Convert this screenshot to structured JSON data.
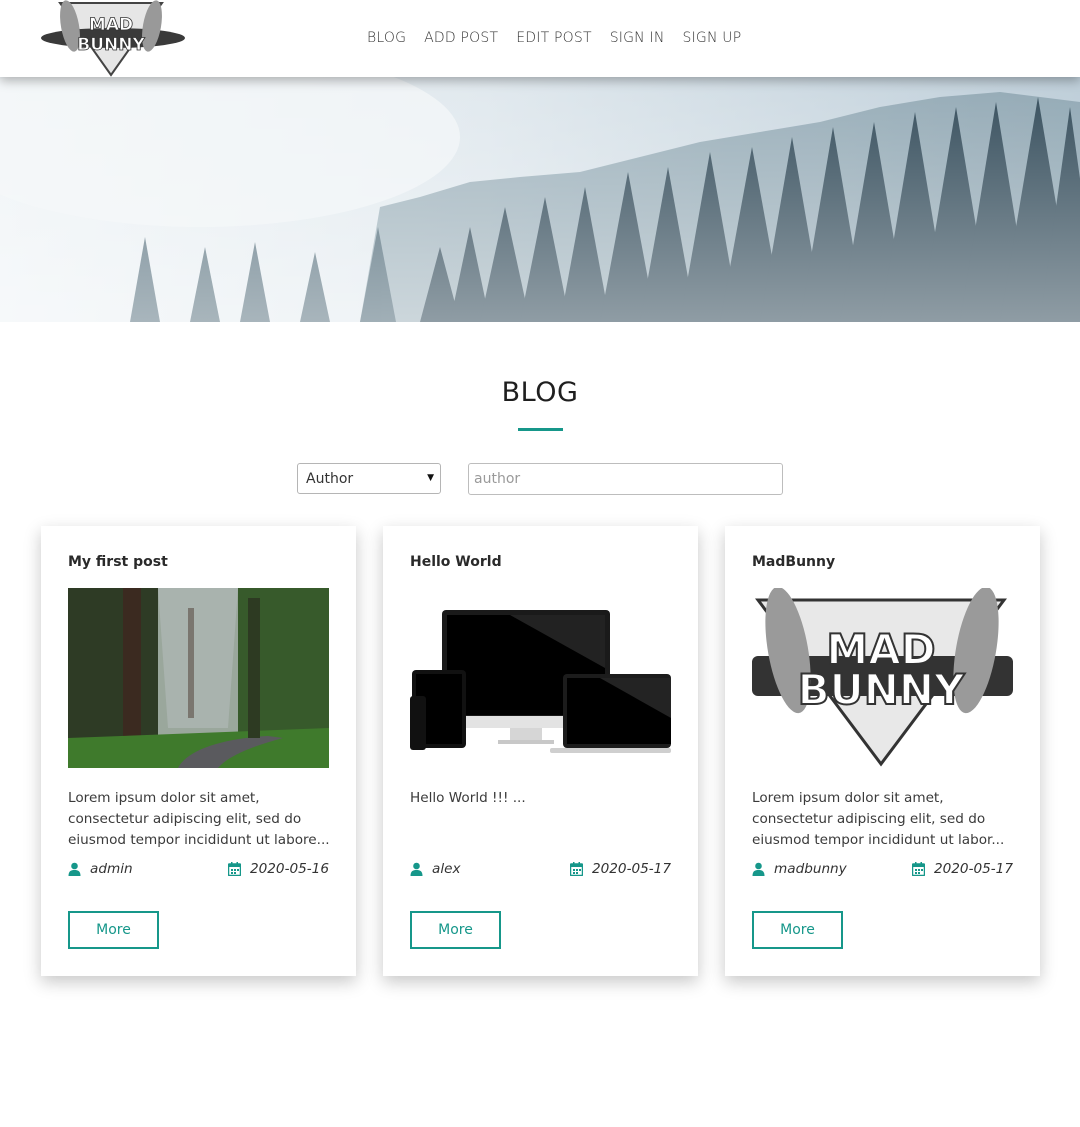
{
  "brand": {
    "logo_text_1": "MAD",
    "logo_text_2": "BUNNY"
  },
  "nav": [
    "BLOG",
    "ADD POST",
    "EDIT POST",
    "SIGN IN",
    "SIGN UP"
  ],
  "section": {
    "title": "BLOG"
  },
  "filter": {
    "select_value": "Author",
    "input_placeholder": "author"
  },
  "colors": {
    "accent": "#16978a",
    "nav_text": "#333333"
  },
  "posts": [
    {
      "title": "My first post",
      "excerpt": "Lorem ipsum dolor sit amet, consectetur adipiscing elit, sed do eiusmod tempor incididunt ut labore...",
      "author": "admin",
      "date": "2020-05-16",
      "button": "More"
    },
    {
      "title": "Hello World",
      "excerpt": "Hello World !!! ...",
      "author": "alex",
      "date": "2020-05-17",
      "button": "More"
    },
    {
      "title": "MadBunny",
      "excerpt": "Lorem ipsum dolor sit amet, consectetur adipiscing elit, sed do eiusmod tempor incididunt ut labor...",
      "author": "madbunny",
      "date": "2020-05-17",
      "button": "More"
    }
  ]
}
